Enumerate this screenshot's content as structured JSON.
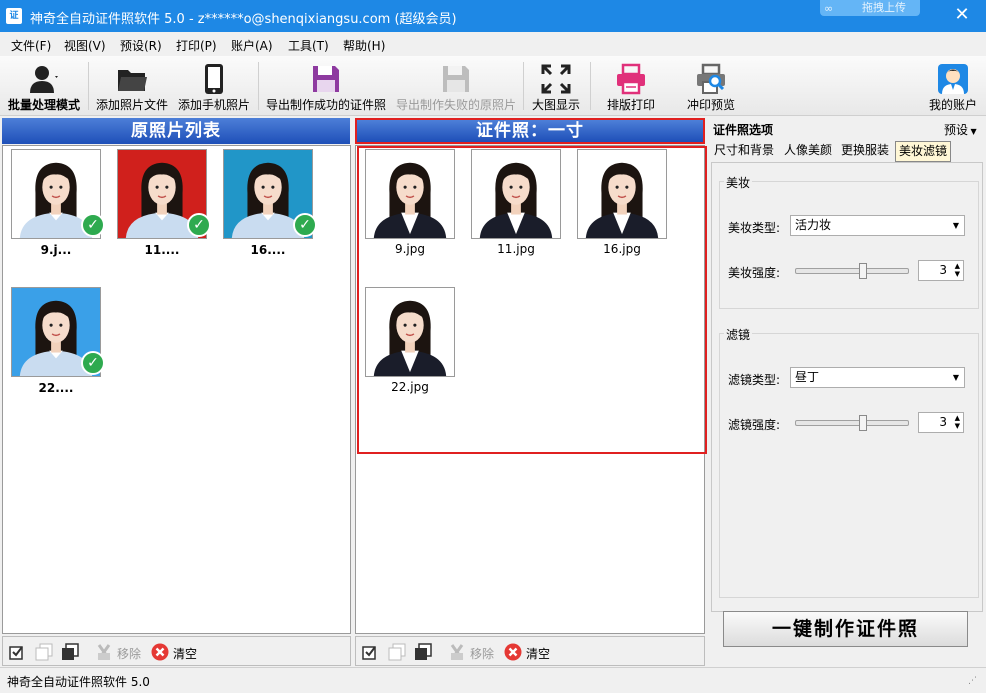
{
  "window": {
    "title": "神奇全自动证件照软件 5.0 - z******o@shenqixiangsu.com (超级会员)",
    "app_icon": "证",
    "cloud_upload": "拖拽上传"
  },
  "menu": [
    "文件(F)",
    "视图(V)",
    "预设(R)",
    "打印(P)",
    "账户(A)",
    "工具(T)",
    "帮助(H)"
  ],
  "toolbar": {
    "batch": "批量处理模式",
    "add_files": "添加照片文件",
    "add_phone": "添加手机照片",
    "export_ok": "导出制作成功的证件照",
    "export_fail": "导出制作失败的原照片",
    "big_view": "大图显示",
    "layout_print": "排版打印",
    "print_preview": "冲印预览",
    "my_account": "我的账户"
  },
  "left_panel": {
    "title": "原照片列表",
    "photos": [
      {
        "label": "9.j...",
        "bg": "#ffffff"
      },
      {
        "label": "11....",
        "bg": "#d0201c"
      },
      {
        "label": "16....",
        "bg": "#2196c8"
      },
      {
        "label": "22....",
        "bg": "#3aa0e8"
      }
    ],
    "remove": "移除",
    "clear": "清空"
  },
  "middle_panel": {
    "title": "证件照：一寸",
    "photos": [
      {
        "label": "9.jpg"
      },
      {
        "label": "11.jpg"
      },
      {
        "label": "16.jpg"
      },
      {
        "label": "22.jpg"
      }
    ],
    "remove": "移除",
    "clear": "清空"
  },
  "options": {
    "title": "证件照选项",
    "preset": "预设",
    "tabs": [
      "尺寸和背景",
      "人像美颜",
      "更换服装",
      "美妆滤镜"
    ],
    "active_tab": "美妆滤镜",
    "makeup": {
      "group": "美妆",
      "type_label": "美妆类型:",
      "type_value": "活力妆",
      "strength_label": "美妆强度:",
      "strength_value": "3",
      "strength_fraction": 0.6
    },
    "filter": {
      "group": "滤镜",
      "type_label": "滤镜类型:",
      "type_value": "昼丁",
      "strength_label": "滤镜强度:",
      "strength_value": "3",
      "strength_fraction": 0.6
    },
    "make_button": "一键制作证件照"
  },
  "status": "神奇全自动证件照软件 5.0",
  "colors": {
    "titlebar": "#1e88e5",
    "check": "#2eaa4f",
    "clear_icon": "#e53935",
    "highlight_border": "#e02020"
  }
}
